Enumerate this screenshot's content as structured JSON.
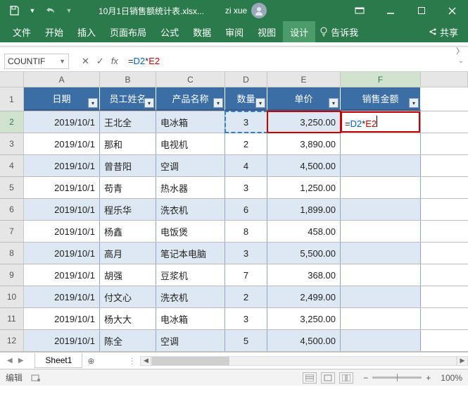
{
  "titlebar": {
    "filename": "10月1日销售额统计表.xlsx...",
    "username": "zi xue"
  },
  "ribbon": {
    "tabs": [
      "文件",
      "开始",
      "插入",
      "页面布局",
      "公式",
      "数据",
      "审阅",
      "视图",
      "设计"
    ],
    "active_tab": "设计",
    "tell_me": "告诉我",
    "share": "共享"
  },
  "formula_bar": {
    "name_box": "COUNTIF",
    "formula_prefix": "=",
    "formula_ref1": "D2",
    "formula_op": "*",
    "formula_ref2": "E2"
  },
  "columns": [
    "A",
    "B",
    "C",
    "D",
    "E",
    "F"
  ],
  "headers": {
    "A": "日期",
    "B": "员工姓名",
    "C": "产品名称",
    "D": "数量",
    "E": "单价",
    "F": "销售金额"
  },
  "active_cell_formula": {
    "prefix": "=",
    "ref1": "D2",
    "op": "*",
    "ref2": "E2"
  },
  "rows": [
    {
      "n": "2",
      "A": "2019/10/1",
      "B": "王北全",
      "C": "电冰箱",
      "D": "3",
      "E": "3,250.00",
      "F": ""
    },
    {
      "n": "3",
      "A": "2019/10/1",
      "B": "那和",
      "C": "电视机",
      "D": "2",
      "E": "3,890.00",
      "F": ""
    },
    {
      "n": "4",
      "A": "2019/10/1",
      "B": "曾昔阳",
      "C": "空调",
      "D": "4",
      "E": "4,500.00",
      "F": ""
    },
    {
      "n": "5",
      "A": "2019/10/1",
      "B": "苟青",
      "C": "热水器",
      "D": "3",
      "E": "1,250.00",
      "F": ""
    },
    {
      "n": "6",
      "A": "2019/10/1",
      "B": "程乐华",
      "C": "洗衣机",
      "D": "6",
      "E": "1,899.00",
      "F": ""
    },
    {
      "n": "7",
      "A": "2019/10/1",
      "B": "杨鑫",
      "C": "电饭煲",
      "D": "8",
      "E": "458.00",
      "F": ""
    },
    {
      "n": "8",
      "A": "2019/10/1",
      "B": "高月",
      "C": "笔记本电脑",
      "D": "3",
      "E": "5,500.00",
      "F": ""
    },
    {
      "n": "9",
      "A": "2019/10/1",
      "B": "胡强",
      "C": "豆浆机",
      "D": "7",
      "E": "368.00",
      "F": ""
    },
    {
      "n": "10",
      "A": "2019/10/1",
      "B": "付文心",
      "C": "洗衣机",
      "D": "2",
      "E": "2,499.00",
      "F": ""
    },
    {
      "n": "11",
      "A": "2019/10/1",
      "B": "杨大大",
      "C": "电冰箱",
      "D": "3",
      "E": "3,250.00",
      "F": ""
    },
    {
      "n": "12",
      "A": "2019/10/1",
      "B": "陈全",
      "C": "空调",
      "D": "5",
      "E": "4,500.00",
      "F": ""
    }
  ],
  "sheet": {
    "tab": "Sheet1"
  },
  "status": {
    "mode": "编辑",
    "zoom": "100%"
  }
}
